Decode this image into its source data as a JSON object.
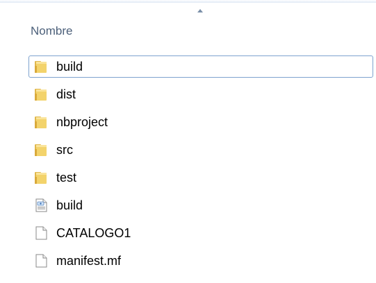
{
  "header": {
    "column_name": "Nombre"
  },
  "files": [
    {
      "label": "build",
      "icon": "folder-icon",
      "focused": true
    },
    {
      "label": "dist",
      "icon": "folder-icon",
      "focused": false
    },
    {
      "label": "nbproject",
      "icon": "folder-icon",
      "focused": false
    },
    {
      "label": "src",
      "icon": "folder-icon",
      "focused": false
    },
    {
      "label": "test",
      "icon": "folder-icon",
      "focused": false
    },
    {
      "label": "build",
      "icon": "xml-file-icon",
      "focused": false
    },
    {
      "label": "CATALOGO1",
      "icon": "file-icon",
      "focused": false
    },
    {
      "label": "manifest.mf",
      "icon": "file-icon",
      "focused": false
    }
  ],
  "colors": {
    "focus_border": "#7da2ce",
    "header_text": "#4c607a",
    "folder_yellow": "#f3d36b"
  }
}
